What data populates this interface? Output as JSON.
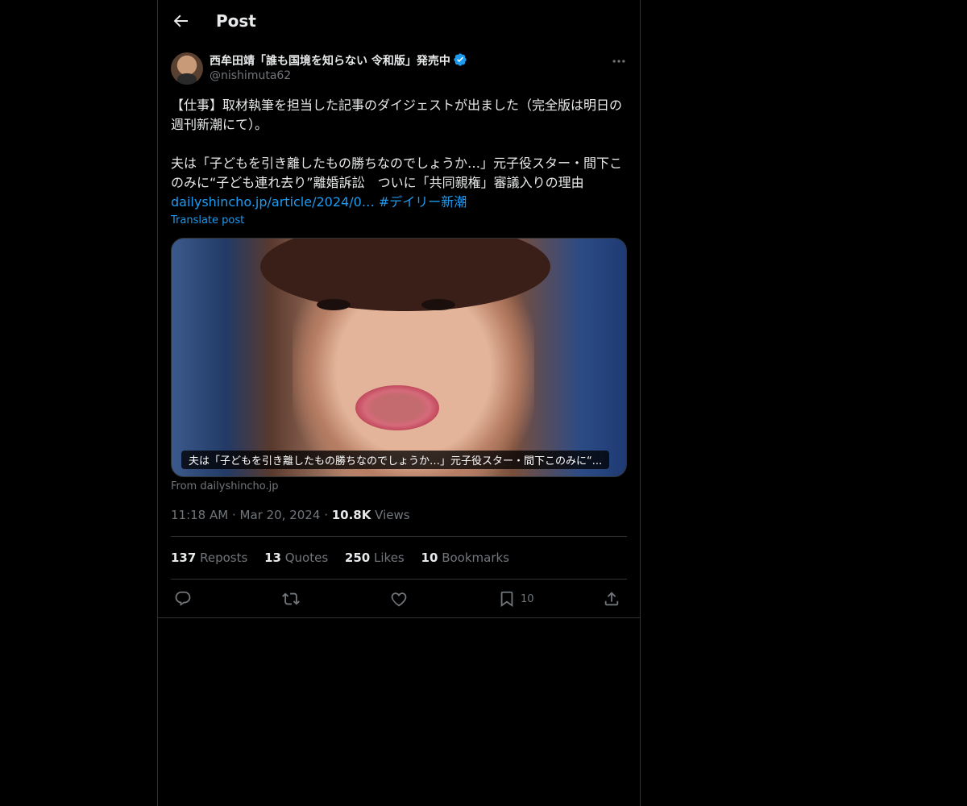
{
  "header": {
    "title": "Post"
  },
  "author": {
    "display_name": "西牟田靖「誰も国境を知らない 令和版」発売中",
    "handle": "@nishimuta62",
    "verified": true
  },
  "post": {
    "paragraph1": "【仕事】取材執筆を担当した記事のダイジェストが出ました（完全版は明日の週刊新潮にて）。",
    "paragraph2_text": "夫は「子どもを引き離したもの勝ちなのでしょうか…」元子役スター・間下このみに“子ども連れ去り”離婚訴訟　ついに「共同親権」審議入りの理由 ",
    "link": "dailyshincho.jp/article/2024/0…",
    "hashtag": "#デイリー新潮",
    "translate_label": "Translate post"
  },
  "media": {
    "caption": "夫は「子どもを引き離したもの勝ちなのでしょうか…」元子役スター・間下このみに“...",
    "source": "From dailyshincho.jp"
  },
  "meta": {
    "time": "11:18 AM",
    "date": "Mar 20, 2024",
    "views_count": "10.8K",
    "views_label": "Views"
  },
  "stats": {
    "reposts_count": "137",
    "reposts_label": "Reposts",
    "quotes_count": "13",
    "quotes_label": "Quotes",
    "likes_count": "250",
    "likes_label": "Likes",
    "bookmarks_count": "10",
    "bookmarks_label": "Bookmarks"
  },
  "actions": {
    "bookmark_count": "10"
  },
  "colors": {
    "accent": "#1d9bf0",
    "muted": "#71767b",
    "border": "#2f3336",
    "text": "#e7e9ea"
  }
}
